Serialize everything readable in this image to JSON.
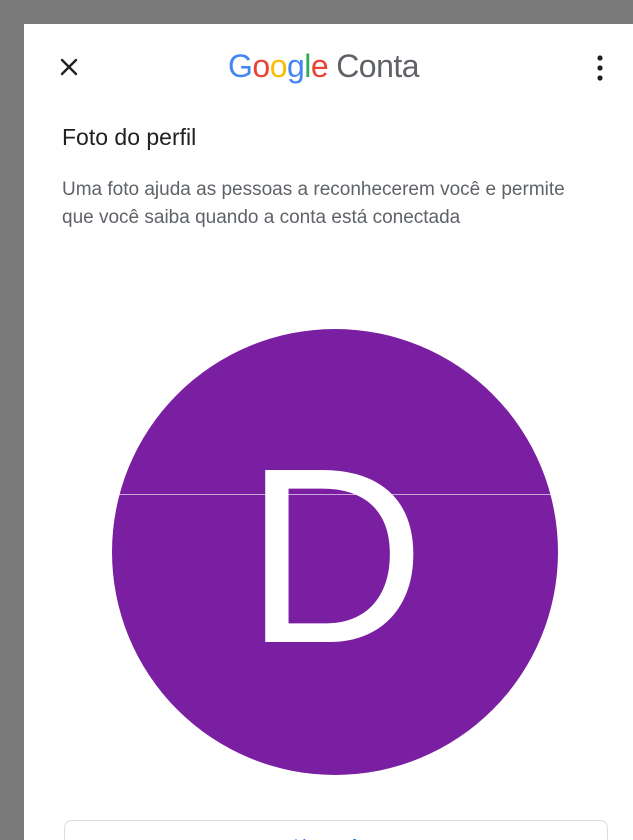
{
  "header": {
    "brand_letters": [
      "G",
      "o",
      "o",
      "g",
      "l",
      "e"
    ],
    "brand_colors": [
      "#4285F4",
      "#EA4335",
      "#FBBC05",
      "#4285F4",
      "#34A853",
      "#EA4335"
    ],
    "product": "Conta",
    "close_icon": "close-icon",
    "more_icon": "more-vert-icon"
  },
  "profile": {
    "title": "Foto do perfil",
    "description": "Uma foto ajuda as pessoas a reconhecerem você e permite que você saiba quando a conta está conectada",
    "avatar_letter": "D",
    "avatar_color": "#7B1FA2"
  },
  "action": {
    "label": "Alterar foto"
  }
}
